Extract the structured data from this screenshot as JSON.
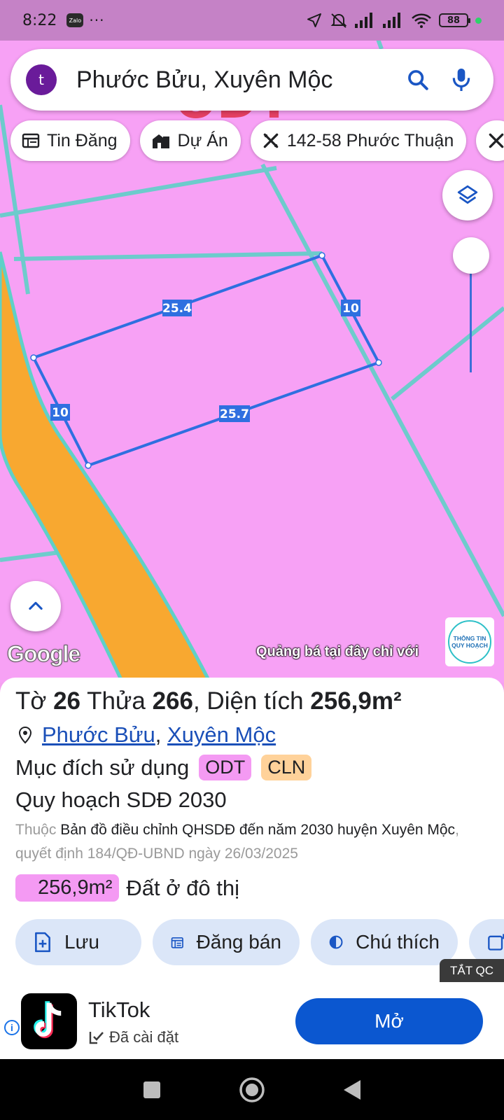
{
  "status_bar": {
    "time": "8:22",
    "zalo": "Zalo",
    "more": "···",
    "battery": "88"
  },
  "search": {
    "avatar_letter": "t",
    "query": "Phước Bửu, Xuyên Mộc"
  },
  "chips": [
    {
      "label": "Tin Đăng",
      "icon": "listing-icon"
    },
    {
      "label": "Dự Án",
      "icon": "building-icon"
    },
    {
      "label": "142-58 Phước Thuận",
      "icon": "ruler-icon"
    }
  ],
  "map": {
    "background_label": "ODT",
    "plot_edges": {
      "top": "25.4",
      "right": "10",
      "bottom": "25.7",
      "left": "10"
    },
    "google_logo": "Google",
    "promo": "Quảng bá tại đây chỉ với",
    "qh_logo_line1": "THÔNG TIN",
    "qh_logo_line2": "QUY HOẠCH",
    "colors": {
      "land": "#f7a1f5",
      "road": "#f8a830",
      "boundary": "#5fd0c8",
      "plot": "#2f6fe0"
    }
  },
  "parcel": {
    "title_prefix": "Tờ ",
    "sheet_no": "26",
    "title_mid": " Thửa ",
    "parcel_no": "266",
    "title_sep": ", Diện tích ",
    "area": "256,9m²",
    "ward": "Phước Bửu",
    "district": "Xuyên Mộc",
    "purpose_label": "Mục đích sử dụng",
    "purpose_codes": [
      "ODT",
      "CLN"
    ],
    "plan_title": "Quy hoạch SDĐ 2030",
    "desc_prefix": "Thuộc ",
    "desc_main": "Bản đồ điều chỉnh QHSDĐ đến năm 2030 huyện Xuyên Mộc",
    "desc_suffix": ", quyết định 184/QĐ-UBND ngày 26/03/2025",
    "zone_area": "256,9m²",
    "zone_name": "Đất ở đô thị"
  },
  "actions": [
    {
      "label": "Lưu",
      "icon": "save-icon"
    },
    {
      "label": "Đăng bán",
      "icon": "calendar-icon"
    },
    {
      "label": "Chú thích",
      "icon": "contrast-icon"
    }
  ],
  "ad": {
    "close_label": "TẮT QC",
    "app_name": "TikTok",
    "installed": "Đã cài đặt",
    "open_label": "Mở"
  }
}
